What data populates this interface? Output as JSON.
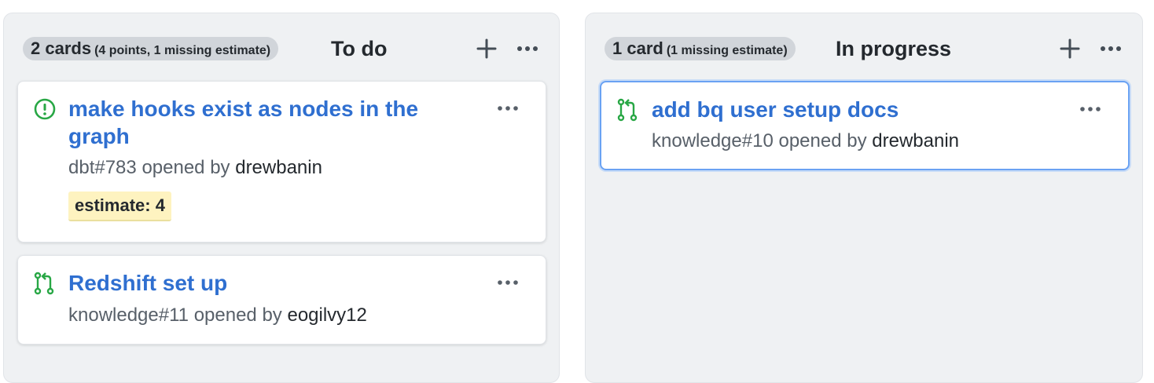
{
  "columns": [
    {
      "count_label": "2 cards",
      "count_detail": "(4 points, 1 missing estimate)",
      "title": "To do",
      "cards": [
        {
          "icon": "issue-open-icon",
          "title": "make hooks exist as nodes in the graph",
          "ref": "dbt#783",
          "opened_by_text": "opened by",
          "author": "drewbanin",
          "label": "estimate: 4"
        },
        {
          "icon": "pull-request-icon",
          "title": "Redshift set up",
          "ref": "knowledge#11",
          "opened_by_text": "opened by",
          "author": "eogilvy12"
        }
      ]
    },
    {
      "count_label": "1 card",
      "count_detail": "(1 missing estimate)",
      "title": "In progress",
      "cards": [
        {
          "icon": "pull-request-icon",
          "title": "add bq user setup docs",
          "ref": "knowledge#10",
          "opened_by_text": "opened by",
          "author": "drewbanin"
        }
      ]
    }
  ],
  "colors": {
    "link": "#2f6fd0",
    "issue_open": "#28a745",
    "pull_request": "#28a745",
    "label_bg": "#fef3c0",
    "selected_border": "#6aa2f3"
  }
}
